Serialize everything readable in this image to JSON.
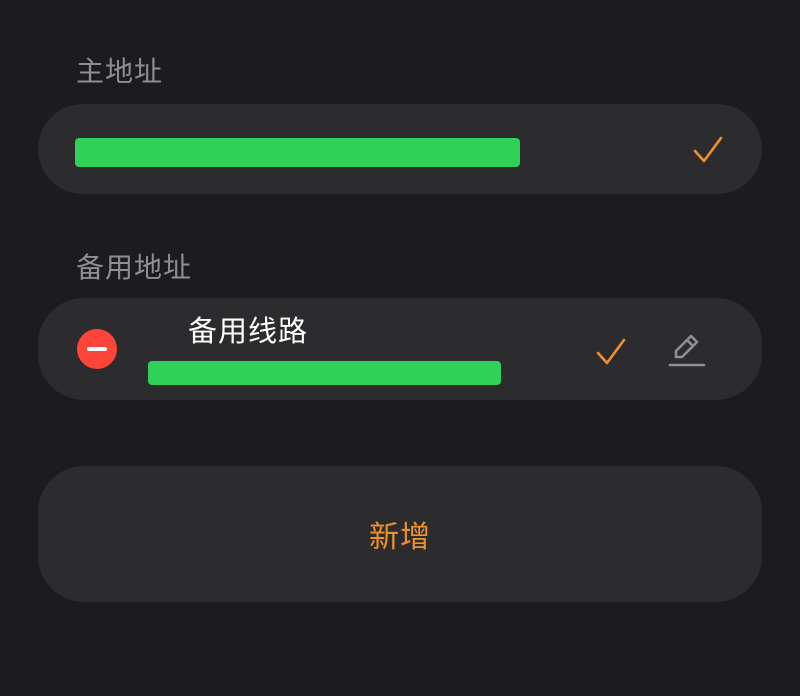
{
  "primary": {
    "section_label": "主地址",
    "selected_icon": "checkmark-icon"
  },
  "backup": {
    "section_label": "备用地址",
    "items": [
      {
        "name": "备用线路",
        "remove_icon": "minus-circle-icon",
        "selected_icon": "checkmark-icon",
        "edit_icon": "pencil-icon"
      }
    ]
  },
  "actions": {
    "add_label": "新增"
  },
  "colors": {
    "background": "#1c1c1e",
    "card": "#2c2c2e",
    "accent": "#f0912a",
    "destructive": "#ff453a",
    "redaction": "#30d158",
    "secondary_text": "#8e8e93"
  }
}
